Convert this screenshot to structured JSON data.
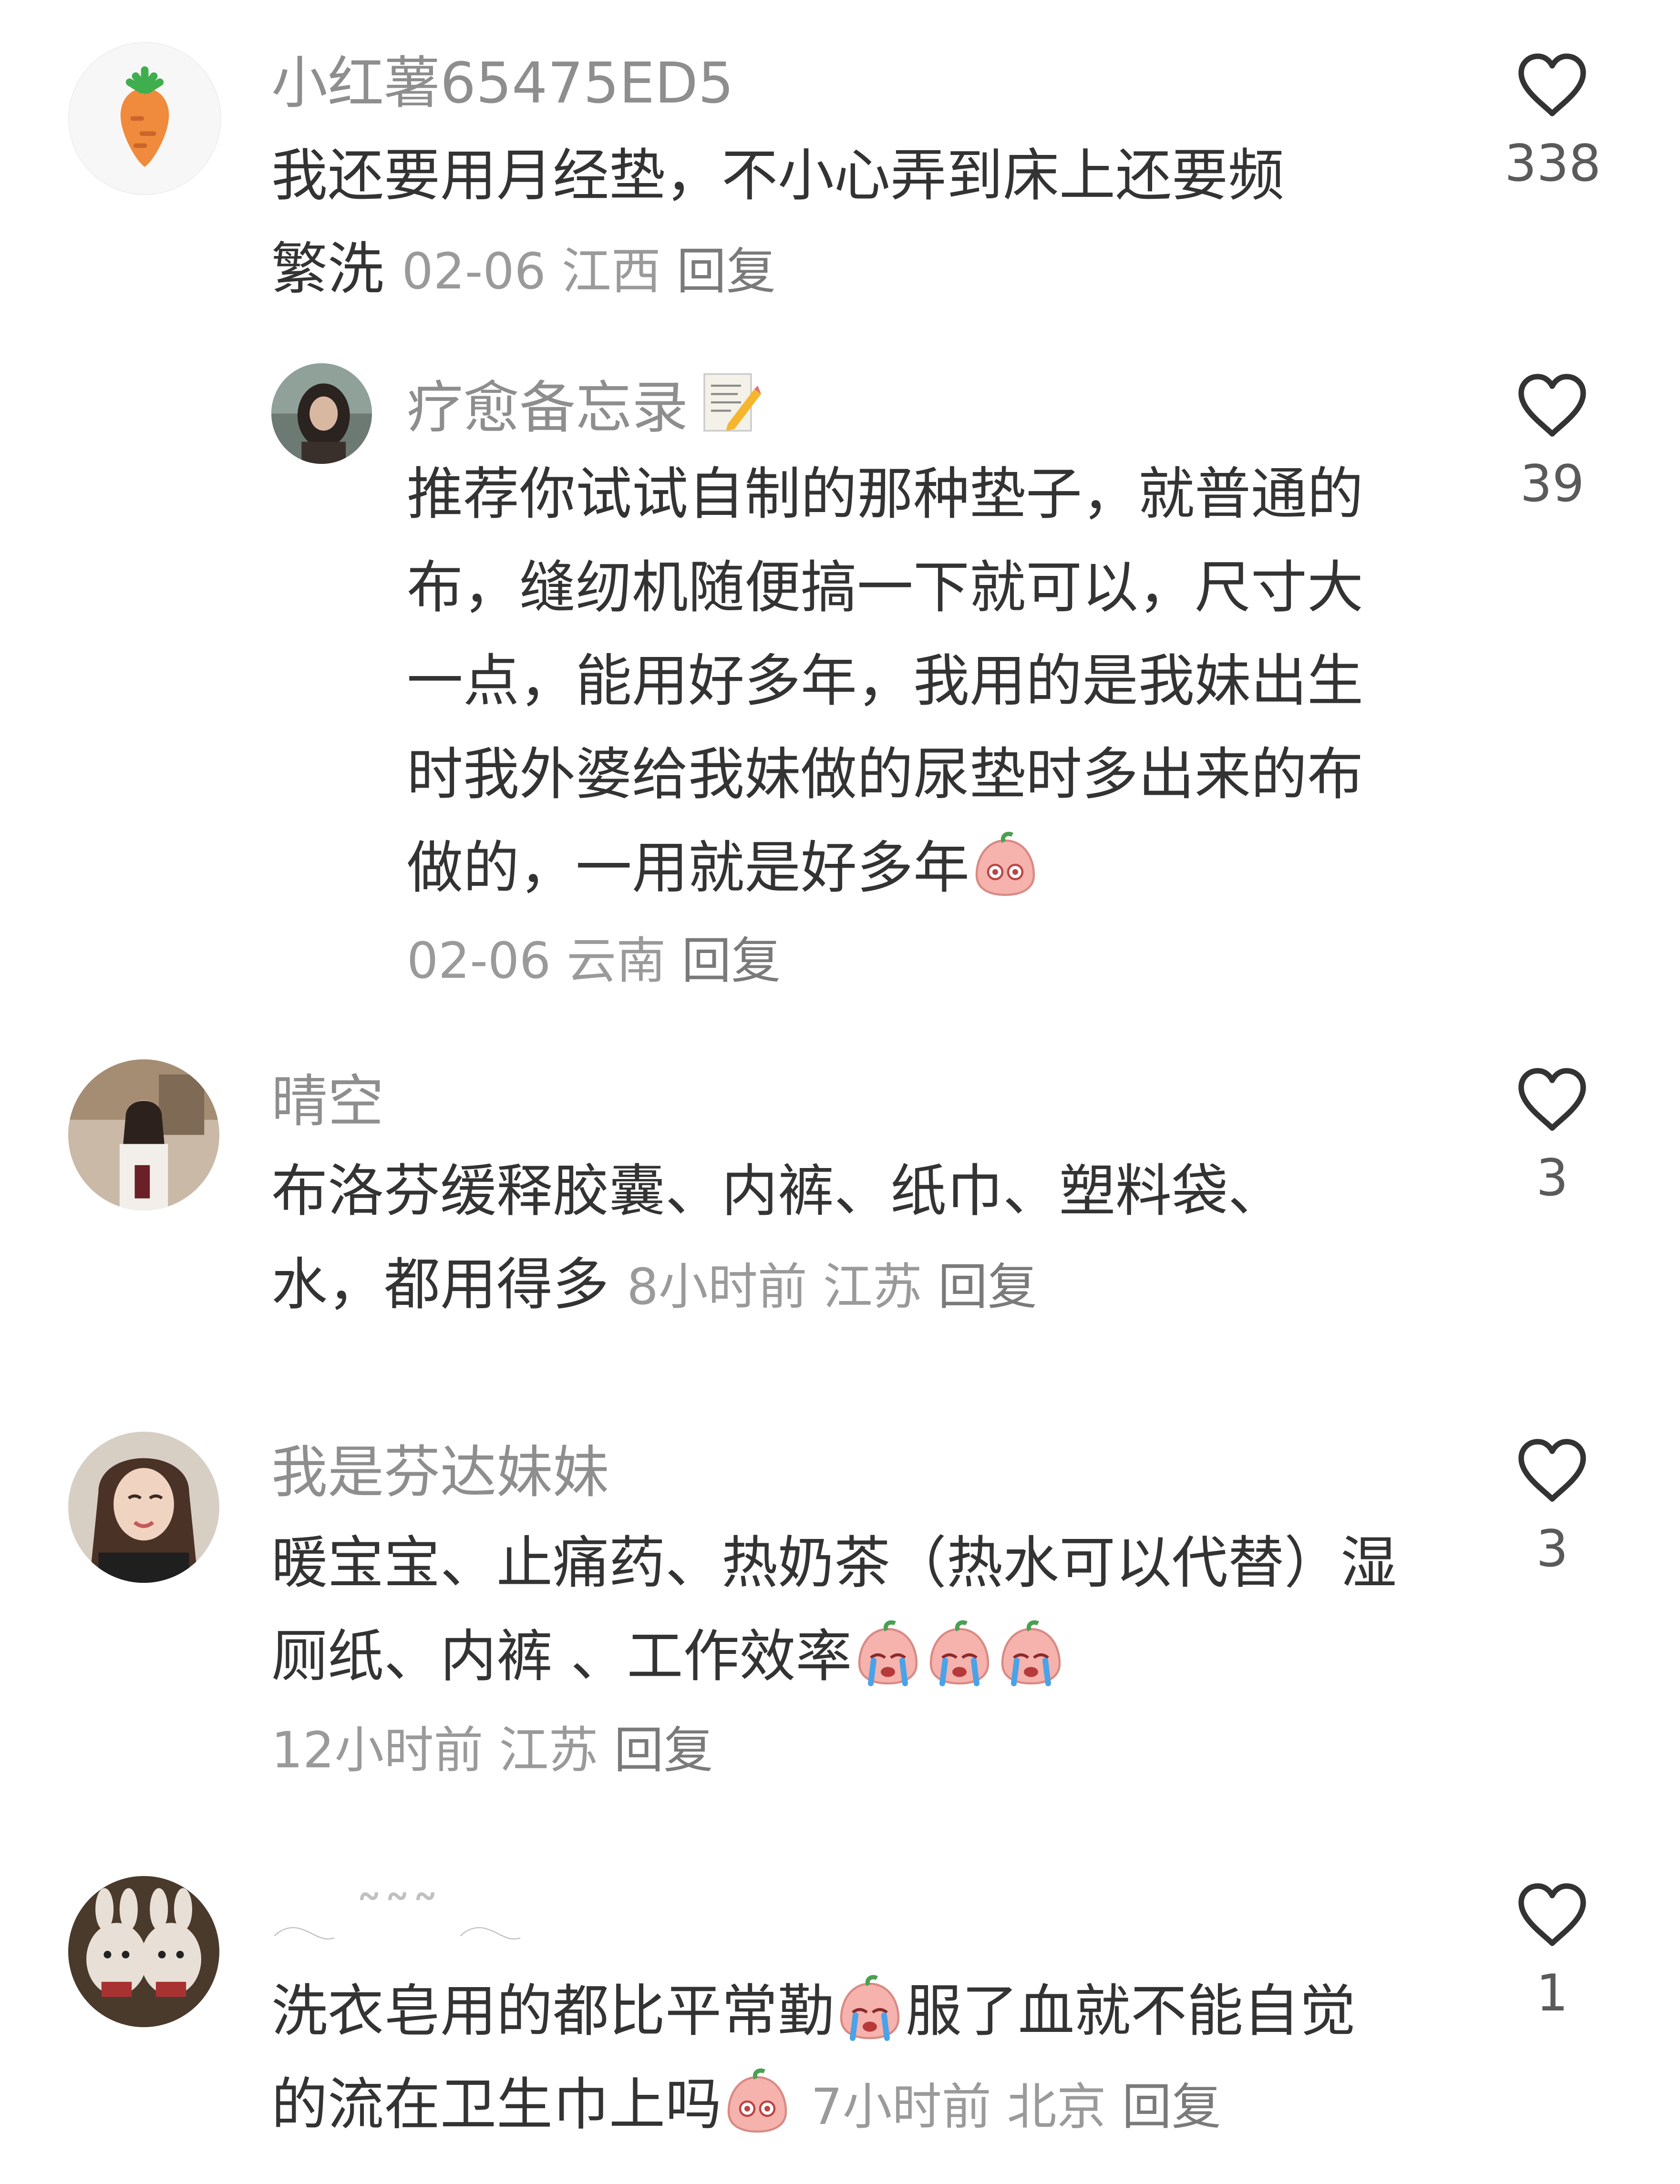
{
  "comments": [
    {
      "name": "小红薯65475ED5",
      "lines": [
        "我还要用月经垫，不小心弄到床上还要频",
        "繁洗"
      ],
      "date": "02-06",
      "location": "江西",
      "reply": "回复",
      "likes": "338",
      "avatar_icon": "carrot-icon"
    },
    {
      "name": "疗愈备忘录",
      "name_emoji": "memo-icon",
      "lines": [
        "推荐你试试自制的那种垫子，就普通的",
        "布，缝纫机随便搞一下就可以，尺寸大",
        "一点，能用好多年，我用的是我妹出生",
        "时我外婆给我妹做的尿垫时多出来的布",
        "做的，一用就是好多年"
      ],
      "date": "02-06",
      "location": "云南",
      "reply": "回复",
      "likes": "39"
    },
    {
      "name": "晴空",
      "lines": [
        "布洛芬缓释胶囊、内裤、纸巾、塑料袋、",
        "水，都用得多"
      ],
      "date": "8小时前",
      "location": "江苏",
      "reply": "回复",
      "likes": "3"
    },
    {
      "name": "我是芬达妹妹",
      "lines": [
        "暖宝宝、止痛药、热奶茶（热水可以代替）湿",
        "厕纸、内裤 、工作效率"
      ],
      "date": "12小时前",
      "location": "江苏",
      "reply": "回复",
      "likes": "3"
    },
    {
      "name": "𓂃 ˜˜˜ 𓂃",
      "lines": [
        "洗衣皂用的都比平常勤",
        "服了血就不能自觉",
        "的流在卫生巾上吗"
      ],
      "date": "7小时前",
      "location": "北京",
      "reply": "回复",
      "likes": "1"
    }
  ],
  "colors": {
    "name": "#8e8e8e",
    "text": "#333333",
    "meta": "#9a9a9a",
    "accent": "#ff2442"
  }
}
